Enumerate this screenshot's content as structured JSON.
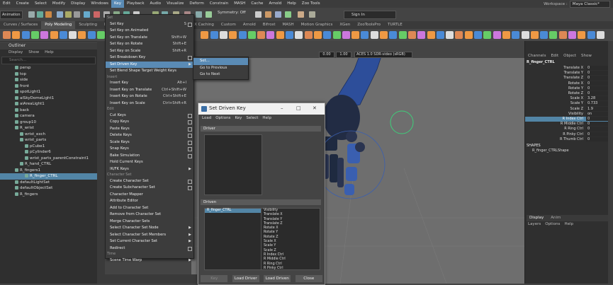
{
  "menubar": [
    "Edit",
    "Create",
    "Select",
    "Modify",
    "Display",
    "Windows",
    "Key",
    "Playback",
    "Audio",
    "Visualize",
    "Deform",
    "Constrain",
    "MASH",
    "Cache",
    "Arnold",
    "Help",
    "Zoo Tools"
  ],
  "menubar_active": "Key",
  "workspace": {
    "label": "Workspace :",
    "value": "Maya Classic*"
  },
  "status": {
    "mode": "Animation",
    "symmetry": "Symmetry: Off",
    "signin": "Sign In"
  },
  "shelf_tabs": [
    "Curves / Surfaces",
    "Poly Modeling",
    "Sculpting",
    "Rigging",
    "Animation",
    "Rendering",
    "FX",
    "FX Caching",
    "Custom",
    "Arnold",
    "Bifrost",
    "MASH",
    "Motion Graphics",
    "XGen",
    "ZooToolsPro",
    "TURTLE"
  ],
  "shelf_tab_active": "Poly Modeling",
  "viewport": {
    "value0": "0.00",
    "value1": "1.00",
    "colorspace": "ACES 1.0 SDR-video (sRGB)"
  },
  "outliner": {
    "title": "Outliner",
    "menu": [
      "Display",
      "Show",
      "Help"
    ],
    "search": "Search...",
    "rows": [
      {
        "label": "persp",
        "indent": 1
      },
      {
        "label": "top",
        "indent": 1
      },
      {
        "label": "side",
        "indent": 1
      },
      {
        "label": "front",
        "indent": 1
      },
      {
        "label": "spotLight1",
        "indent": 1
      },
      {
        "label": "aiSkyDomeLight1",
        "indent": 1
      },
      {
        "label": "aiAreaLight1",
        "indent": 1
      },
      {
        "label": "back",
        "indent": 1
      },
      {
        "label": "camera",
        "indent": 1
      },
      {
        "label": "group10",
        "indent": 1
      },
      {
        "label": "R_wrist",
        "indent": 1
      },
      {
        "label": "wrist_exch",
        "indent": 2
      },
      {
        "label": "wrist_parts",
        "indent": 2
      },
      {
        "label": "pCube1",
        "indent": 3
      },
      {
        "label": "pCylinder6",
        "indent": 3
      },
      {
        "label": "wrist_parts_parentConstraint1",
        "indent": 3
      },
      {
        "label": "R_hand_CTRL",
        "indent": 2
      },
      {
        "label": "R_fingers1",
        "indent": 1
      },
      {
        "label": "R_finger_CTRL",
        "indent": 3,
        "selected": true
      },
      {
        "label": "defaultLightSet",
        "indent": 1
      },
      {
        "label": "defaultObjectSet",
        "indent": 1
      },
      {
        "label": "R_fingers",
        "indent": 1
      }
    ]
  },
  "key_menu": {
    "items": [
      {
        "label": "Set",
        "type": "section"
      },
      {
        "label": "Set Key",
        "shortcut": "S",
        "option": true
      },
      {
        "label": "Set Key on Animated"
      },
      {
        "label": "Set Key on Translate",
        "shortcut": "Shift+W"
      },
      {
        "label": "Set Key on Rotate",
        "shortcut": "Shift+E"
      },
      {
        "label": "Set Key on Scale",
        "shortcut": "Shift+R"
      },
      {
        "label": "Set Breakdown Key",
        "option": true
      },
      {
        "label": "Set Driven Key",
        "submenu": true,
        "highlighted": true
      },
      {
        "label": "Set Blend Shape Target Weight Keys"
      },
      {
        "label": "Insert",
        "type": "section"
      },
      {
        "label": "Insert Key",
        "shortcut": "Alt+I"
      },
      {
        "label": "Insert Key on Translate",
        "shortcut": "Ctrl+Shift+W"
      },
      {
        "label": "Insert Key on Rotate",
        "shortcut": "Ctrl+Shift+E"
      },
      {
        "label": "Insert Key on Scale",
        "shortcut": "Ctrl+Shift+R"
      },
      {
        "label": "Edit",
        "type": "section"
      },
      {
        "label": "Cut Keys",
        "option": true
      },
      {
        "label": "Copy Keys",
        "option": true
      },
      {
        "label": "Paste Keys",
        "option": true
      },
      {
        "label": "Delete Keys",
        "option": true
      },
      {
        "label": "Scale Keys",
        "option": true
      },
      {
        "label": "Snap Keys",
        "option": true
      },
      {
        "label": "Bake Simulation",
        "option": true
      },
      {
        "label": "Hold Current Keys"
      },
      {
        "label": "IK/FK Keys",
        "submenu": true
      },
      {
        "label": "Character Set",
        "type": "section"
      },
      {
        "label": "Create Character Set",
        "option": true
      },
      {
        "label": "Create Subcharacter Set",
        "option": true
      },
      {
        "label": "Character Mapper"
      },
      {
        "label": "Attribute Editor"
      },
      {
        "label": "Add to Character Set"
      },
      {
        "label": "Remove from Character Set"
      },
      {
        "label": "Merge Character Sets"
      },
      {
        "label": "Select Character Set Node",
        "submenu": true
      },
      {
        "label": "Select Character Set Members",
        "submenu": true
      },
      {
        "label": "Set Current Character Set",
        "submenu": true
      },
      {
        "label": "Redirect",
        "option": true
      },
      {
        "label": "Time",
        "type": "section"
      },
      {
        "label": "Scene Time Warp",
        "submenu": true
      }
    ]
  },
  "submenu": {
    "items": [
      "Set...",
      "Go to Previous",
      "Go to Next"
    ]
  },
  "sdk_dialog": {
    "title": "Set Driven Key",
    "menu": [
      "Load",
      "Options",
      "Key",
      "Select",
      "Help"
    ],
    "driver_label": "Driver",
    "driven_label": "Driven",
    "driven_objects": [
      "R_finger_CTRL"
    ],
    "driven_attrs": [
      "Visibility",
      "Translate X",
      "Translate Y",
      "Translate Z",
      "Rotate X",
      "Rotate Y",
      "Rotate Z",
      "Scale X",
      "Scale Y",
      "Scale Z",
      "R Index Ctrl",
      "R Middle Ctrl",
      "R Ring Ctrl",
      "R Pinky Ctrl"
    ],
    "buttons": [
      "Key",
      "Load Driver",
      "Load Driven",
      "Close"
    ]
  },
  "channel_box": {
    "menu": [
      "Channels",
      "Edit",
      "Object",
      "Show"
    ],
    "object": "R_finger_CTRL",
    "channels": [
      {
        "name": "Translate X",
        "value": "0"
      },
      {
        "name": "Translate Y",
        "value": "0"
      },
      {
        "name": "Translate Z",
        "value": "0"
      },
      {
        "name": "Rotate X",
        "value": "0"
      },
      {
        "name": "Rotate Y",
        "value": "0"
      },
      {
        "name": "Rotate Z",
        "value": "0"
      },
      {
        "name": "Scale X",
        "value": "3.28"
      },
      {
        "name": "Scale Y",
        "value": "0.733"
      },
      {
        "name": "Scale Z",
        "value": "1.9"
      },
      {
        "name": "Visibility",
        "value": "on"
      },
      {
        "name": "R Index Ctrl",
        "value": "0",
        "selected": true
      },
      {
        "name": "R Middle Ctrl",
        "value": "0"
      },
      {
        "name": "R Ring Ctrl",
        "value": "0"
      },
      {
        "name": "R Pinky Ctrl",
        "value": "0"
      },
      {
        "name": "R Thumb Ctrl",
        "value": "0"
      }
    ],
    "shapes_label": "SHAPES",
    "shape": "R_finger_CTRLShape",
    "layer_tabs": [
      "Display",
      "Anim"
    ],
    "layer_menu": [
      "Layers",
      "Options",
      "Help"
    ]
  },
  "colors": {
    "highlight": "#5a8bb5",
    "selection": "#5285a6",
    "hand": "#3a5fb0",
    "ring": "#3ecf7a"
  }
}
